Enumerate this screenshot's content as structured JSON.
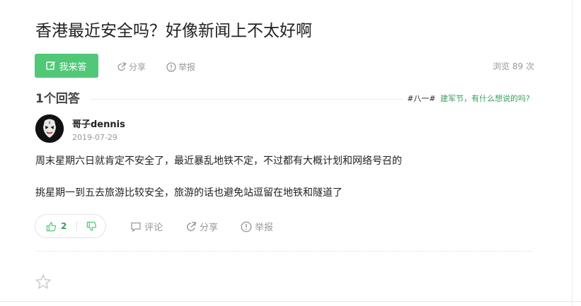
{
  "question": {
    "title": "香港最近安全吗？好像新闻上不太好啊",
    "answer_button": "我来答",
    "share_label": "分享",
    "report_label": "举报",
    "views": "浏览 89 次"
  },
  "answers_section": {
    "count_title": "1个回答",
    "promo_tag": "#八一#",
    "promo_text": "建军节，有什么想说的吗?"
  },
  "answer": {
    "author": "哥子dennis",
    "date": "2019-07-29",
    "paragraphs": [
      "周末星期六日就肯定不安全了，最近暴乱地铁不定，不过都有大概计划和网络号召的",
      "挑星期一到五去旅游比较安全，旅游的话也避免站逗留在地铁和隧道了"
    ],
    "upvotes": "2",
    "comment_label": "评论",
    "share_label": "分享",
    "report_label": "举报"
  },
  "icons": {
    "edit": "edit-icon",
    "share": "share-icon",
    "report": "report-icon",
    "thumb_up": "thumb-up-icon",
    "thumb_down": "thumb-down-icon",
    "comment": "comment-icon",
    "star": "star-icon"
  },
  "colors": {
    "accent": "#50c878",
    "link_green": "#3a9d5d",
    "muted": "#999999"
  }
}
